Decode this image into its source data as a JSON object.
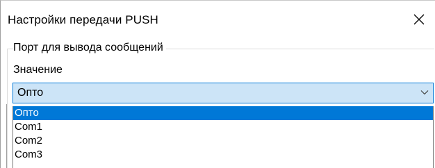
{
  "window": {
    "title": "Настройки передачи PUSH",
    "close_icon": "close-icon"
  },
  "group": {
    "legend": "Порт для вывода сообщений",
    "field_label": "Значение"
  },
  "combo": {
    "value": "Опто",
    "arrow_icon": "chevron-down-icon",
    "focus_color": "#0078d7",
    "background_color": "#cce4f7"
  },
  "dropdown": {
    "options": [
      {
        "label": "Опто",
        "selected": true
      },
      {
        "label": "Com1",
        "selected": false
      },
      {
        "label": "Com2",
        "selected": false
      },
      {
        "label": "Com3",
        "selected": false
      }
    ],
    "selected_color": "#0078d7"
  }
}
